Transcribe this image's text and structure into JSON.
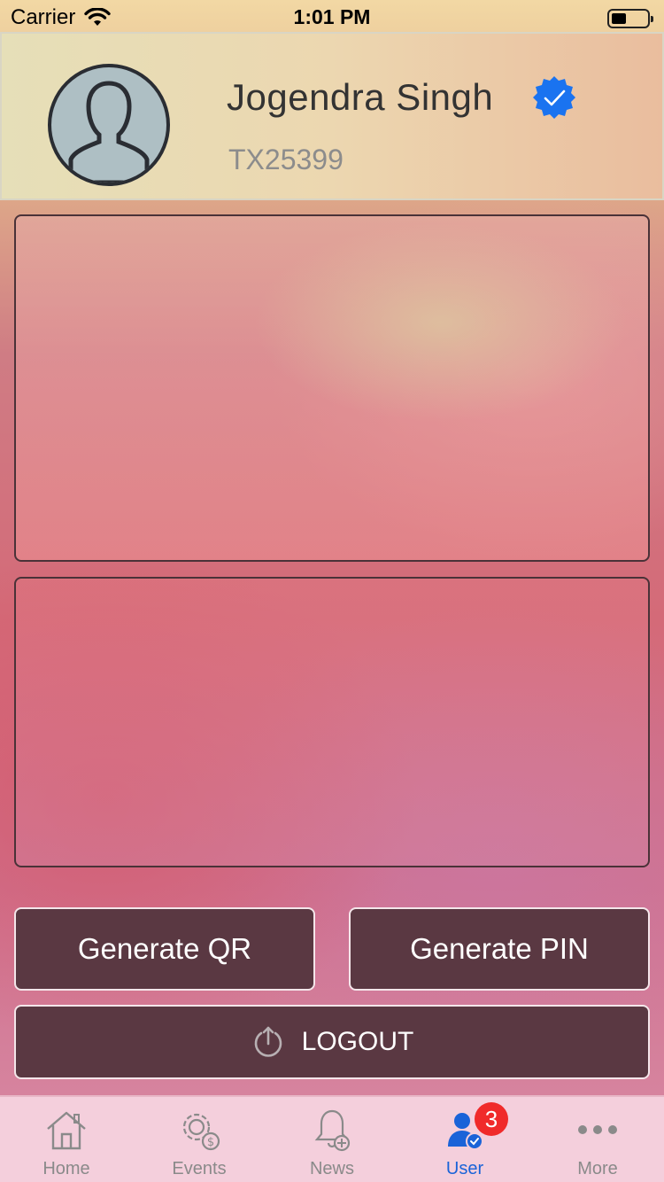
{
  "status_bar": {
    "carrier": "Carrier",
    "time": "1:01 PM"
  },
  "profile": {
    "name": "Jogendra Singh",
    "id": "TX25399",
    "verified": true
  },
  "actions": {
    "generate_qr": "Generate QR",
    "generate_pin": "Generate PIN",
    "logout": "LOGOUT"
  },
  "tabs": [
    {
      "label": "Home",
      "icon": "home-icon"
    },
    {
      "label": "Events",
      "icon": "gear-dollar-icon"
    },
    {
      "label": "News",
      "icon": "bell-plus-icon"
    },
    {
      "label": "User",
      "icon": "user-check-icon",
      "badge": "3",
      "active": true
    },
    {
      "label": "More",
      "icon": "more-dots-icon"
    }
  ],
  "colors": {
    "accent": "#1a63d8",
    "button_bg": "#5a3842",
    "badge": "#f02a2a",
    "verified": "#1a73f0"
  }
}
